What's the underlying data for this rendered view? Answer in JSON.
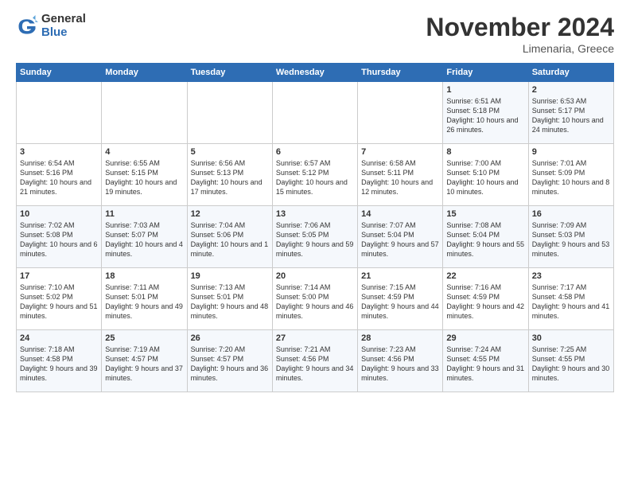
{
  "logo": {
    "general": "General",
    "blue": "Blue"
  },
  "title": "November 2024",
  "subtitle": "Limenaria, Greece",
  "days_header": [
    "Sunday",
    "Monday",
    "Tuesday",
    "Wednesday",
    "Thursday",
    "Friday",
    "Saturday"
  ],
  "weeks": [
    [
      {
        "day": "",
        "data": ""
      },
      {
        "day": "",
        "data": ""
      },
      {
        "day": "",
        "data": ""
      },
      {
        "day": "",
        "data": ""
      },
      {
        "day": "",
        "data": ""
      },
      {
        "day": "1",
        "data": "Sunrise: 6:51 AM\nSunset: 5:18 PM\nDaylight: 10 hours and 26 minutes."
      },
      {
        "day": "2",
        "data": "Sunrise: 6:53 AM\nSunset: 5:17 PM\nDaylight: 10 hours and 24 minutes."
      }
    ],
    [
      {
        "day": "3",
        "data": "Sunrise: 6:54 AM\nSunset: 5:16 PM\nDaylight: 10 hours and 21 minutes."
      },
      {
        "day": "4",
        "data": "Sunrise: 6:55 AM\nSunset: 5:15 PM\nDaylight: 10 hours and 19 minutes."
      },
      {
        "day": "5",
        "data": "Sunrise: 6:56 AM\nSunset: 5:13 PM\nDaylight: 10 hours and 17 minutes."
      },
      {
        "day": "6",
        "data": "Sunrise: 6:57 AM\nSunset: 5:12 PM\nDaylight: 10 hours and 15 minutes."
      },
      {
        "day": "7",
        "data": "Sunrise: 6:58 AM\nSunset: 5:11 PM\nDaylight: 10 hours and 12 minutes."
      },
      {
        "day": "8",
        "data": "Sunrise: 7:00 AM\nSunset: 5:10 PM\nDaylight: 10 hours and 10 minutes."
      },
      {
        "day": "9",
        "data": "Sunrise: 7:01 AM\nSunset: 5:09 PM\nDaylight: 10 hours and 8 minutes."
      }
    ],
    [
      {
        "day": "10",
        "data": "Sunrise: 7:02 AM\nSunset: 5:08 PM\nDaylight: 10 hours and 6 minutes."
      },
      {
        "day": "11",
        "data": "Sunrise: 7:03 AM\nSunset: 5:07 PM\nDaylight: 10 hours and 4 minutes."
      },
      {
        "day": "12",
        "data": "Sunrise: 7:04 AM\nSunset: 5:06 PM\nDaylight: 10 hours and 1 minute."
      },
      {
        "day": "13",
        "data": "Sunrise: 7:06 AM\nSunset: 5:05 PM\nDaylight: 9 hours and 59 minutes."
      },
      {
        "day": "14",
        "data": "Sunrise: 7:07 AM\nSunset: 5:04 PM\nDaylight: 9 hours and 57 minutes."
      },
      {
        "day": "15",
        "data": "Sunrise: 7:08 AM\nSunset: 5:04 PM\nDaylight: 9 hours and 55 minutes."
      },
      {
        "day": "16",
        "data": "Sunrise: 7:09 AM\nSunset: 5:03 PM\nDaylight: 9 hours and 53 minutes."
      }
    ],
    [
      {
        "day": "17",
        "data": "Sunrise: 7:10 AM\nSunset: 5:02 PM\nDaylight: 9 hours and 51 minutes."
      },
      {
        "day": "18",
        "data": "Sunrise: 7:11 AM\nSunset: 5:01 PM\nDaylight: 9 hours and 49 minutes."
      },
      {
        "day": "19",
        "data": "Sunrise: 7:13 AM\nSunset: 5:01 PM\nDaylight: 9 hours and 48 minutes."
      },
      {
        "day": "20",
        "data": "Sunrise: 7:14 AM\nSunset: 5:00 PM\nDaylight: 9 hours and 46 minutes."
      },
      {
        "day": "21",
        "data": "Sunrise: 7:15 AM\nSunset: 4:59 PM\nDaylight: 9 hours and 44 minutes."
      },
      {
        "day": "22",
        "data": "Sunrise: 7:16 AM\nSunset: 4:59 PM\nDaylight: 9 hours and 42 minutes."
      },
      {
        "day": "23",
        "data": "Sunrise: 7:17 AM\nSunset: 4:58 PM\nDaylight: 9 hours and 41 minutes."
      }
    ],
    [
      {
        "day": "24",
        "data": "Sunrise: 7:18 AM\nSunset: 4:58 PM\nDaylight: 9 hours and 39 minutes."
      },
      {
        "day": "25",
        "data": "Sunrise: 7:19 AM\nSunset: 4:57 PM\nDaylight: 9 hours and 37 minutes."
      },
      {
        "day": "26",
        "data": "Sunrise: 7:20 AM\nSunset: 4:57 PM\nDaylight: 9 hours and 36 minutes."
      },
      {
        "day": "27",
        "data": "Sunrise: 7:21 AM\nSunset: 4:56 PM\nDaylight: 9 hours and 34 minutes."
      },
      {
        "day": "28",
        "data": "Sunrise: 7:23 AM\nSunset: 4:56 PM\nDaylight: 9 hours and 33 minutes."
      },
      {
        "day": "29",
        "data": "Sunrise: 7:24 AM\nSunset: 4:55 PM\nDaylight: 9 hours and 31 minutes."
      },
      {
        "day": "30",
        "data": "Sunrise: 7:25 AM\nSunset: 4:55 PM\nDaylight: 9 hours and 30 minutes."
      }
    ]
  ]
}
